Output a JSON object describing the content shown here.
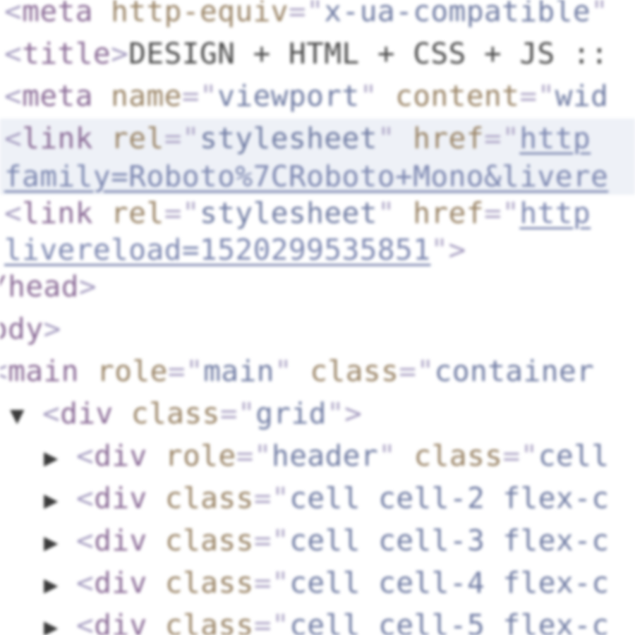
{
  "lines": [
    {
      "id": "meta-http-equiv",
      "tokens": [
        {
          "k": "b",
          "s": "<"
        },
        {
          "k": "t",
          "s": "meta"
        },
        {
          "k": "a",
          "s": " http-equiv"
        },
        {
          "k": "eq",
          "s": "=\""
        },
        {
          "k": "v",
          "s": "x-ua-compatible"
        },
        {
          "k": "eq",
          "s": "\""
        }
      ]
    },
    {
      "id": "title",
      "tokens": [
        {
          "k": "b",
          "s": "<"
        },
        {
          "k": "t",
          "s": "title"
        },
        {
          "k": "b",
          "s": ">"
        },
        {
          "k": "txt",
          "s": "DESIGN + HTML + CSS + JS ::"
        }
      ]
    },
    {
      "id": "meta-viewport",
      "tokens": [
        {
          "k": "b",
          "s": "<"
        },
        {
          "k": "t",
          "s": "meta"
        },
        {
          "k": "a",
          "s": " name"
        },
        {
          "k": "eq",
          "s": "=\""
        },
        {
          "k": "v",
          "s": "viewport"
        },
        {
          "k": "eq",
          "s": "\""
        },
        {
          "k": "a",
          "s": " content"
        },
        {
          "k": "eq",
          "s": "=\""
        },
        {
          "k": "v",
          "s": "wid"
        }
      ]
    },
    {
      "id": "link-stylesheet-1",
      "tokens": [
        {
          "k": "b",
          "s": "<"
        },
        {
          "k": "t",
          "s": "link"
        },
        {
          "k": "a",
          "s": " rel"
        },
        {
          "k": "eq",
          "s": "=\""
        },
        {
          "k": "v",
          "s": "stylesheet"
        },
        {
          "k": "eq",
          "s": "\""
        },
        {
          "k": "a",
          "s": " href"
        },
        {
          "k": "eq",
          "s": "=\""
        },
        {
          "k": "u",
          "s": "http"
        }
      ]
    },
    {
      "id": "link-stylesheet-1-cont",
      "tokens": [
        {
          "k": "u",
          "s": "family=Roboto%7CRoboto+Mono&livere"
        }
      ]
    },
    {
      "id": "link-stylesheet-2",
      "tokens": [
        {
          "k": "b",
          "s": "<"
        },
        {
          "k": "t",
          "s": "link"
        },
        {
          "k": "a",
          "s": " rel"
        },
        {
          "k": "eq",
          "s": "=\""
        },
        {
          "k": "v",
          "s": "stylesheet"
        },
        {
          "k": "eq",
          "s": "\""
        },
        {
          "k": "a",
          "s": " href"
        },
        {
          "k": "eq",
          "s": "=\""
        },
        {
          "k": "u",
          "s": "http"
        }
      ]
    },
    {
      "id": "link-stylesheet-2-cont",
      "tokens": [
        {
          "k": "u",
          "s": "livereload=1520299535851"
        },
        {
          "k": "eq",
          "s": "\""
        },
        {
          "k": "b",
          "s": ">"
        }
      ]
    },
    {
      "id": "head-close",
      "tokens": [
        {
          "k": "t",
          "s": "/head"
        },
        {
          "k": "b",
          "s": ">"
        }
      ]
    },
    {
      "id": "body-open",
      "tokens": [
        {
          "k": "t",
          "s": "ody"
        },
        {
          "k": "b",
          "s": ">"
        }
      ]
    },
    {
      "id": "main-open",
      "tokens": [
        {
          "k": "b",
          "s": "<"
        },
        {
          "k": "t",
          "s": "main"
        },
        {
          "k": "a",
          "s": " role"
        },
        {
          "k": "eq",
          "s": "=\""
        },
        {
          "k": "v",
          "s": "main"
        },
        {
          "k": "eq",
          "s": "\""
        },
        {
          "k": "a",
          "s": " class"
        },
        {
          "k": "eq",
          "s": "=\""
        },
        {
          "k": "v",
          "s": "container"
        }
      ]
    },
    {
      "id": "div-grid",
      "twisty": "▼",
      "tokens": [
        {
          "k": "b",
          "s": "<"
        },
        {
          "k": "t",
          "s": "div"
        },
        {
          "k": "a",
          "s": " class"
        },
        {
          "k": "eq",
          "s": "=\""
        },
        {
          "k": "v",
          "s": "grid"
        },
        {
          "k": "eq",
          "s": "\""
        },
        {
          "k": "b",
          "s": ">"
        }
      ]
    },
    {
      "id": "div-header",
      "twisty": "▶",
      "tokens": [
        {
          "k": "b",
          "s": "<"
        },
        {
          "k": "t",
          "s": "div"
        },
        {
          "k": "a",
          "s": " role"
        },
        {
          "k": "eq",
          "s": "=\""
        },
        {
          "k": "v",
          "s": "header"
        },
        {
          "k": "eq",
          "s": "\""
        },
        {
          "k": "a",
          "s": " class"
        },
        {
          "k": "eq",
          "s": "=\""
        },
        {
          "k": "v",
          "s": "cell"
        }
      ]
    },
    {
      "id": "div-cell-2",
      "twisty": "▶",
      "tokens": [
        {
          "k": "b",
          "s": "<"
        },
        {
          "k": "t",
          "s": "div"
        },
        {
          "k": "a",
          "s": " class"
        },
        {
          "k": "eq",
          "s": "=\""
        },
        {
          "k": "v",
          "s": "cell cell-2 flex-c"
        }
      ]
    },
    {
      "id": "div-cell-3",
      "twisty": "▶",
      "tokens": [
        {
          "k": "b",
          "s": "<"
        },
        {
          "k": "t",
          "s": "div"
        },
        {
          "k": "a",
          "s": " class"
        },
        {
          "k": "eq",
          "s": "=\""
        },
        {
          "k": "v",
          "s": "cell cell-3 flex-c"
        }
      ]
    },
    {
      "id": "div-cell-4",
      "twisty": "▶",
      "tokens": [
        {
          "k": "b",
          "s": "<"
        },
        {
          "k": "t",
          "s": "div"
        },
        {
          "k": "a",
          "s": " class"
        },
        {
          "k": "eq",
          "s": "=\""
        },
        {
          "k": "v",
          "s": "cell cell-4 flex-c"
        }
      ]
    },
    {
      "id": "div-cell-5",
      "twisty": "▶",
      "tokens": [
        {
          "k": "b",
          "s": "<"
        },
        {
          "k": "t",
          "s": "div"
        },
        {
          "k": "a",
          "s": " class"
        },
        {
          "k": "eq",
          "s": "=\""
        },
        {
          "k": "v",
          "s": "cell cell-5 flex-c"
        }
      ]
    }
  ]
}
